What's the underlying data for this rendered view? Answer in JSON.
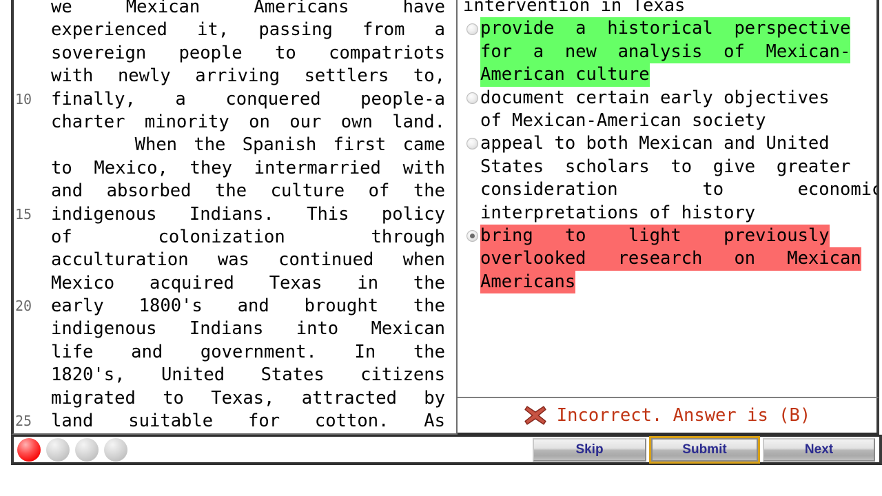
{
  "passage": {
    "lines": [
      {
        "num": "",
        "text": "we   Mexican   Americans   have"
      },
      {
        "num": "",
        "text": "experienced it, passing from a"
      },
      {
        "num": "",
        "text": "sovereign people to compatriots"
      },
      {
        "num": "",
        "text": "with newly arriving settlers to,"
      },
      {
        "num": "10",
        "text": "finally, a conquered people-a"
      },
      {
        "num": "",
        "text": "charter minority on our own land."
      },
      {
        "num": "",
        "text": "     When the Spanish first came"
      },
      {
        "num": "",
        "text": "to Mexico, they intermarried with"
      },
      {
        "num": "",
        "text": "and absorbed the culture of the"
      },
      {
        "num": "15",
        "text": "indigenous Indians. This policy"
      },
      {
        "num": "",
        "text": "of colonization through"
      },
      {
        "num": "",
        "text": "acculturation was continued when"
      },
      {
        "num": "",
        "text": "Mexico acquired Texas in the"
      },
      {
        "num": "20",
        "text": "early 1800's and brought the"
      },
      {
        "num": "",
        "text": "indigenous Indians into Mexican"
      },
      {
        "num": "",
        "text": "life and government. In the"
      },
      {
        "num": "",
        "text": "1820's, United States citizens"
      },
      {
        "num": "",
        "text": "migrated to Texas, attracted by"
      },
      {
        "num": "25",
        "text": "land suitable for cotton. As"
      }
    ]
  },
  "question": {
    "stem_visible": "intervention in Texas",
    "choices": [
      {
        "selected": false,
        "highlight": "green",
        "lines": [
          "provide  a  historical  perspective",
          "for  a  new  analysis  of  Mexican-",
          "American culture"
        ]
      },
      {
        "selected": false,
        "highlight": "none",
        "lines": [
          "document certain early objectives",
          "of Mexican-American society"
        ]
      },
      {
        "selected": false,
        "highlight": "none",
        "lines": [
          "appeal to both Mexican and United",
          "States  scholars  to  give  greater",
          "consideration        to       economic",
          "interpretations of history"
        ]
      },
      {
        "selected": true,
        "highlight": "red",
        "lines": [
          "bring   to    light    previously",
          "overlooked   research   on   Mexican",
          "Americans"
        ]
      }
    ]
  },
  "feedback": {
    "icon": "x-mark-icon",
    "text": "Incorrect. Answer is (B)",
    "color": "#c03514"
  },
  "toolbar": {
    "progress_dots": [
      {
        "state": "incorrect",
        "color": "#f60000"
      },
      {
        "state": "unanswered",
        "color": "#c2c2c2"
      },
      {
        "state": "unanswered",
        "color": "#c2c2c2"
      },
      {
        "state": "unanswered",
        "color": "#c2c2c2"
      }
    ],
    "skip_label": "Skip",
    "submit_label": "Submit",
    "next_label": "Next",
    "focused_button": "Submit"
  },
  "colors": {
    "highlight_correct": "#66ff66",
    "highlight_wrong": "#fc6a6a",
    "button_text": "#2b2b8f",
    "focus_ring": "#d9a117"
  }
}
